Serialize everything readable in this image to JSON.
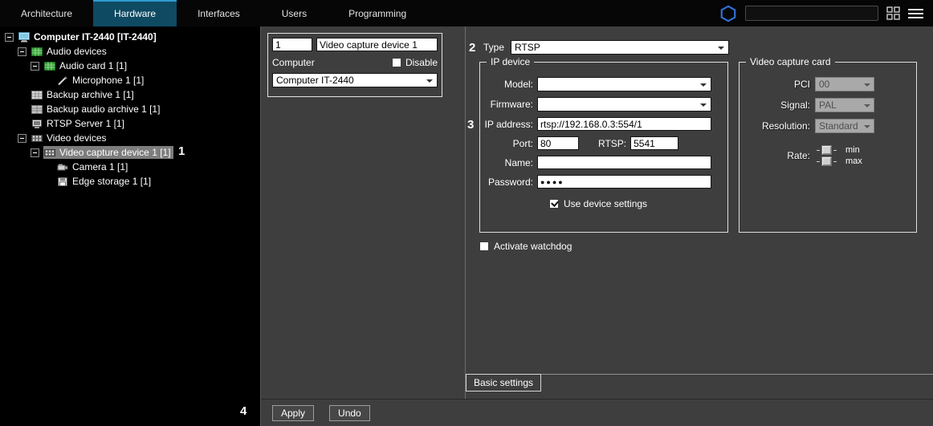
{
  "annotations": {
    "step1": "1",
    "step2": "2",
    "step3": "3",
    "step4": "4"
  },
  "menubar": {
    "items": [
      {
        "label": "Architecture",
        "active": false
      },
      {
        "label": "Hardware",
        "active": true
      },
      {
        "label": "Interfaces",
        "active": false
      },
      {
        "label": "Users",
        "active": false
      },
      {
        "label": "Programming",
        "active": false
      }
    ],
    "search": {
      "value": "",
      "placeholder": ""
    }
  },
  "tree": {
    "items": [
      {
        "label": "Computer IT-2440 [IT-2440]",
        "level": 0,
        "bold": true,
        "selected": false
      },
      {
        "label": "Audio devices",
        "level": 1,
        "selected": false
      },
      {
        "label": "Audio card 1 [1]",
        "level": 2,
        "selected": false
      },
      {
        "label": "Microphone 1 [1]",
        "level": 3,
        "selected": false
      },
      {
        "label": "Backup archive 1 [1]",
        "level": 1,
        "selected": false
      },
      {
        "label": "Backup audio archive 1 [1]",
        "level": 1,
        "selected": false
      },
      {
        "label": "RTSP Server 1 [1]",
        "level": 1,
        "selected": false
      },
      {
        "label": "Video devices",
        "level": 1,
        "selected": false
      },
      {
        "label": "Video capture device 1 [1]",
        "level": 2,
        "selected": true
      },
      {
        "label": "Camera 1 [1]",
        "level": 3,
        "selected": false
      },
      {
        "label": "Edge storage 1 [1]",
        "level": 3,
        "selected": false
      }
    ]
  },
  "device_card": {
    "id_value": "1",
    "name_value": "Video capture device 1",
    "computer_label": "Computer",
    "disable_label": "Disable",
    "disable_checked": false,
    "computer_value": "Computer IT-2440"
  },
  "settings": {
    "type_label": "Type",
    "type_value": "RTSP",
    "ip_device": {
      "legend": "IP device",
      "model_label": "Model:",
      "model_value": "",
      "firmware_label": "Firmware:",
      "firmware_value": "",
      "ip_label": "IP address:",
      "ip_value": "rtsp://192.168.0.3:554/1",
      "port_label": "Port:",
      "port_value": "80",
      "rtsp_label": "RTSP:",
      "rtsp_value": "5541",
      "name_label": "Name:",
      "name_value": "",
      "password_label": "Password:",
      "password_value": "●●●●",
      "use_device_settings_label": "Use device settings",
      "use_device_settings_checked": true
    },
    "video_capture_card": {
      "legend": "Video capture card",
      "pci_label": "PCI",
      "pci_value": "00",
      "signal_label": "Signal:",
      "signal_value": "PAL",
      "resolution_label": "Resolution:",
      "resolution_value": "Standard",
      "rate_label": "Rate:",
      "min_label": "min",
      "max_label": "max"
    },
    "watchdog_label": "Activate watchdog",
    "watchdog_checked": false,
    "tab_label": "Basic settings"
  },
  "footer": {
    "apply_label": "Apply",
    "undo_label": "Undo"
  },
  "icons": {
    "logo-hexagon-icon": "blue hexagon outline",
    "grid-icon": "four squares",
    "menu-icon": "hamburger lines",
    "collapse-icon": "minus box",
    "computer-icon": "monitor",
    "audio-devices-icon": "green card",
    "audio-card-icon": "green card",
    "microphone-icon": "pencil",
    "backup-archive-icon": "gray grid",
    "backup-audio-archive-icon": "gray grid",
    "rtsp-server-icon": "monitor",
    "video-devices-icon": "film strip",
    "video-capture-device-icon": "film strip",
    "camera-icon": "camera",
    "edge-storage-icon": "floppy disk",
    "chevron-down-icon": "dropdown arrow"
  }
}
